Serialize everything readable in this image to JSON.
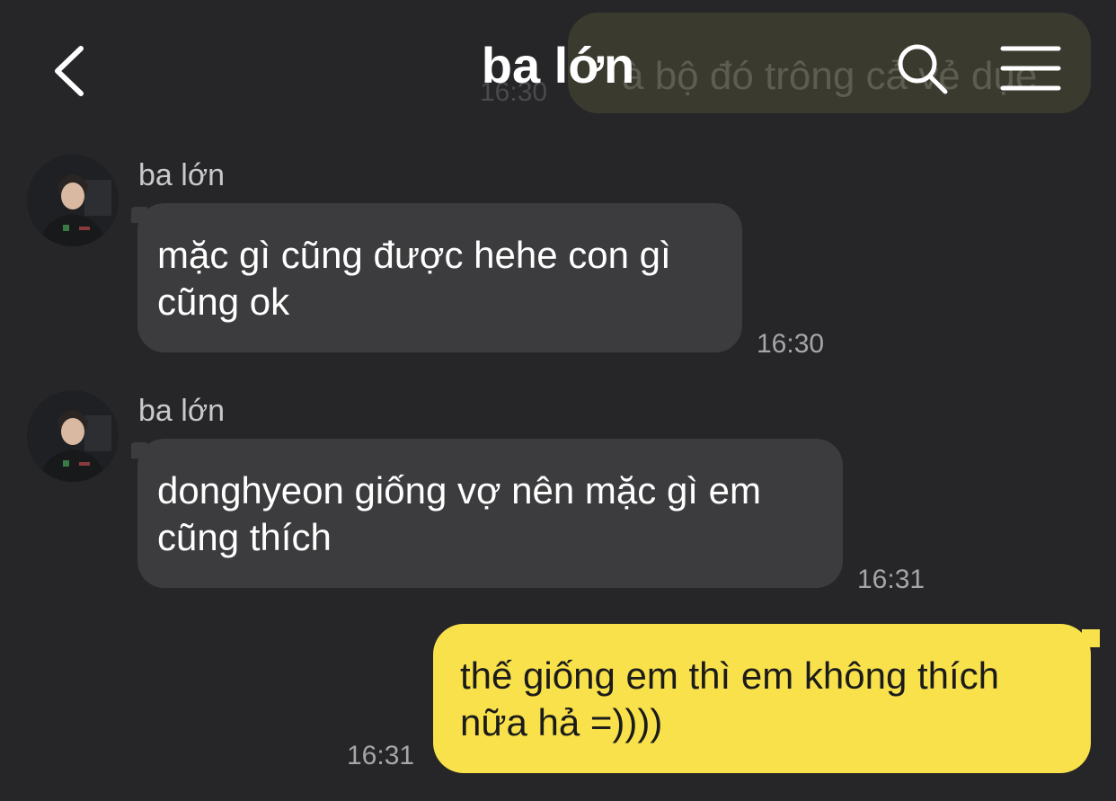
{
  "header": {
    "title": "ba lớn",
    "back_icon": "chevron-left-icon",
    "search_icon": "search-icon",
    "menu_icon": "menu-icon"
  },
  "previous_message": {
    "text": "à bộ đó trông cả vẻ dụe",
    "time": "16:30"
  },
  "messages": [
    {
      "sender": "ba lớn",
      "line1": "mặc gì cũng được hehe con gì",
      "line2": "cũng ok",
      "time": "16:30",
      "direction": "incoming"
    },
    {
      "sender": "ba lớn",
      "line1": "donghyeon giống vợ nên mặc gì em",
      "line2": "cũng thích",
      "time": "16:31",
      "direction": "incoming"
    },
    {
      "line1": "thế giống em thì em không thích",
      "line2": "nữa hả =))))",
      "time": "16:31",
      "direction": "outgoing"
    }
  ],
  "colors": {
    "background": "#262628",
    "incoming_bubble": "#3c3c3e",
    "outgoing_bubble": "#f8e14b",
    "timestamp": "#a6a6aa"
  }
}
